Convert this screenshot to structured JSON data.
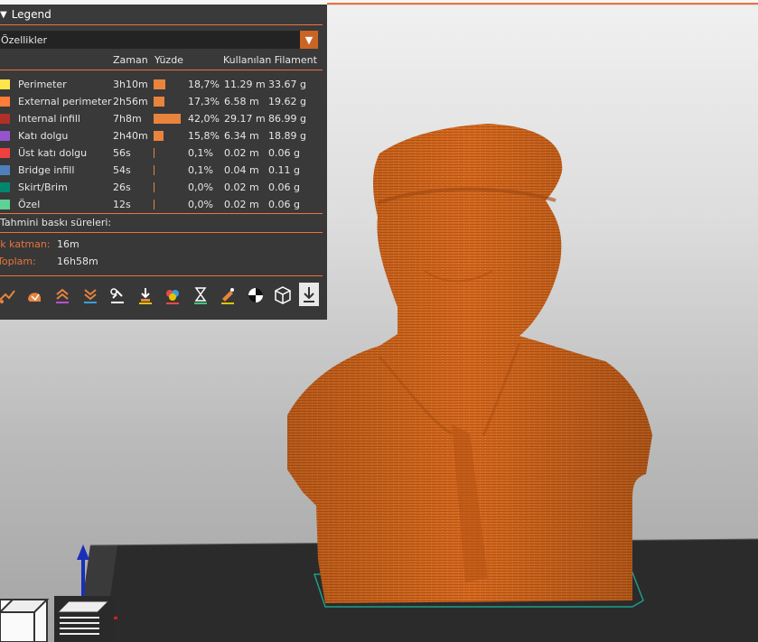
{
  "legend": {
    "title": "Legend",
    "property_select": "Özellikler",
    "columns": {
      "time": "Zaman",
      "percent": "Yüzde",
      "filament": "Kullanılan Filament"
    },
    "rows": [
      {
        "name": "Perimeter",
        "time": "3h10m",
        "percent": "18,7%",
        "length": "11.29 m",
        "weight": "33.67 g",
        "color": "#ffe64d",
        "share": 0.187
      },
      {
        "name": "External perimeter",
        "time": "2h56m",
        "percent": "17,3%",
        "length": "6.58 m",
        "weight": "19.62 g",
        "color": "#ff7d38",
        "share": 0.173
      },
      {
        "name": "Internal infill",
        "time": "7h8m",
        "percent": "42,0%",
        "length": "29.17 m",
        "weight": "86.99 g",
        "color": "#b03029",
        "share": 0.42
      },
      {
        "name": "Katı dolgu",
        "time": "2h40m",
        "percent": "15,8%",
        "length": "6.34 m",
        "weight": "18.89 g",
        "color": "#9654cc",
        "share": 0.158
      },
      {
        "name": "Üst katı dolgu",
        "time": "56s",
        "percent": "0,1%",
        "length": "0.02 m",
        "weight": "0.06 g",
        "color": "#f04040",
        "share": 0.001
      },
      {
        "name": "Bridge infill",
        "time": "54s",
        "percent": "0,1%",
        "length": "0.04 m",
        "weight": "0.11 g",
        "color": "#4d80ba",
        "share": 0.001
      },
      {
        "name": "Skirt/Brim",
        "time": "26s",
        "percent": "0,0%",
        "length": "0.02 m",
        "weight": "0.06 g",
        "color": "#00876e",
        "share": 0.0
      },
      {
        "name": "Özel",
        "time": "12s",
        "percent": "0,0%",
        "length": "0.02 m",
        "weight": "0.06 g",
        "color": "#5ed194",
        "share": 0.0
      }
    ],
    "estimated_label": "Tahmini baskı süreleri:",
    "first_layer_label": "İlk katman:",
    "first_layer_value": "16m",
    "total_label": "Toplam:",
    "total_value": "16h58m"
  },
  "toolbar_icons": [
    "travel-icon",
    "retractions-icon",
    "wipe-icon",
    "seams-icon",
    "tool-changes-icon",
    "color-changes-icon",
    "pause-icon",
    "custom-gcode-icon",
    "center-of-gravity-icon",
    "shells-icon",
    "tool-marker-icon"
  ],
  "colors": {
    "accent": "#e8743b",
    "model": "#d76a1f",
    "panel": "#2f2f2f"
  }
}
